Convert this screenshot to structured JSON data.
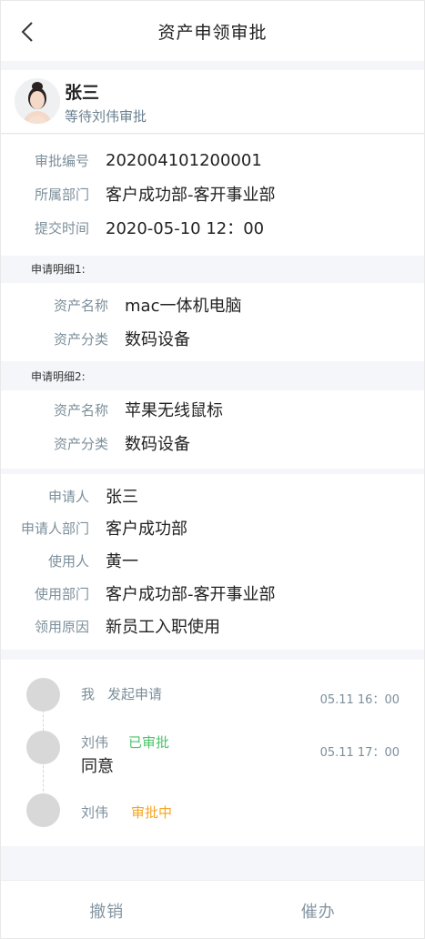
{
  "header": {
    "title": "资产申领审批"
  },
  "applicant": {
    "name": "张三",
    "status": "等待刘伟审批"
  },
  "basic": [
    {
      "label": "审批编号",
      "value": "202004101200001"
    },
    {
      "label": "所属部门",
      "value": "客户成功部-客开事业部"
    },
    {
      "label": "提交时间",
      "value": "2020-05-10 12：00"
    }
  ],
  "details": [
    {
      "title": "申请明细1:",
      "fields": [
        {
          "label": "资产名称",
          "value": "mac一体机电脑"
        },
        {
          "label": "资产分类",
          "value": "数码设备"
        }
      ]
    },
    {
      "title": "申请明细2:",
      "fields": [
        {
          "label": "资产名称",
          "value": "苹果无线鼠标"
        },
        {
          "label": "资产分类",
          "value": "数码设备"
        }
      ]
    }
  ],
  "apply": [
    {
      "label": "申请人",
      "value": "张三"
    },
    {
      "label": "申请人部门",
      "value": "客户成功部"
    },
    {
      "label": "使用人",
      "value": "黄一"
    },
    {
      "label": "使用部门",
      "value": "客户成功部-客开事业部"
    },
    {
      "label": "领用原因",
      "value": "新员工入职使用"
    }
  ],
  "timeline": [
    {
      "name": "我",
      "action": "发起申请",
      "action_color": "#7c8f9b",
      "time": "05.11 16：00",
      "comment": ""
    },
    {
      "name": "刘伟",
      "action": "已审批",
      "action_color": "#4cc46a",
      "time": "05.11 17：00",
      "comment": "同意"
    },
    {
      "name": "刘伟",
      "action": "审批中",
      "action_color": "#f5a623",
      "time": "",
      "comment": ""
    }
  ],
  "footer": {
    "cancel_label": "撤销",
    "urge_label": "催办"
  }
}
